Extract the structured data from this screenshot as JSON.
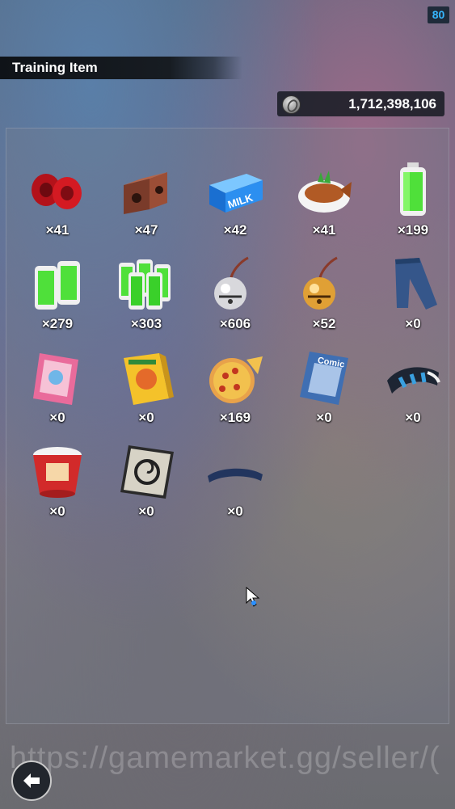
{
  "status_bar": {
    "battery": "80"
  },
  "header": {
    "title": "Training Item"
  },
  "currency": {
    "value": "1,712,398,106",
    "icon": "coin-icon"
  },
  "items": [
    {
      "name": "red-weights",
      "count": "×41"
    },
    {
      "name": "brick-blocks",
      "count": "×47"
    },
    {
      "name": "milk-crate",
      "count": "×42",
      "label": "MILK"
    },
    {
      "name": "fish-dish",
      "count": "×41"
    },
    {
      "name": "green-battery",
      "count": "×199"
    },
    {
      "name": "green-battery-pack",
      "count": "×279"
    },
    {
      "name": "green-battery-bundle",
      "count": "×303"
    },
    {
      "name": "silver-bell",
      "count": "×606"
    },
    {
      "name": "gold-bell",
      "count": "×52"
    },
    {
      "name": "jeans",
      "count": "×0"
    },
    {
      "name": "magazine",
      "count": "×0"
    },
    {
      "name": "game-box",
      "count": "×0"
    },
    {
      "name": "pizza",
      "count": "×169"
    },
    {
      "name": "comic-book",
      "count": "×0",
      "label": "Comic"
    },
    {
      "name": "striped-scarf",
      "count": "×0"
    },
    {
      "name": "cup-noodles",
      "count": "×0"
    },
    {
      "name": "capsule-card",
      "count": "×0"
    },
    {
      "name": "blue-headband",
      "count": "×0"
    }
  ],
  "watermark": "https://gamemarket.gg/seller/(",
  "footer": {
    "back_icon": "back-arrow-icon"
  }
}
